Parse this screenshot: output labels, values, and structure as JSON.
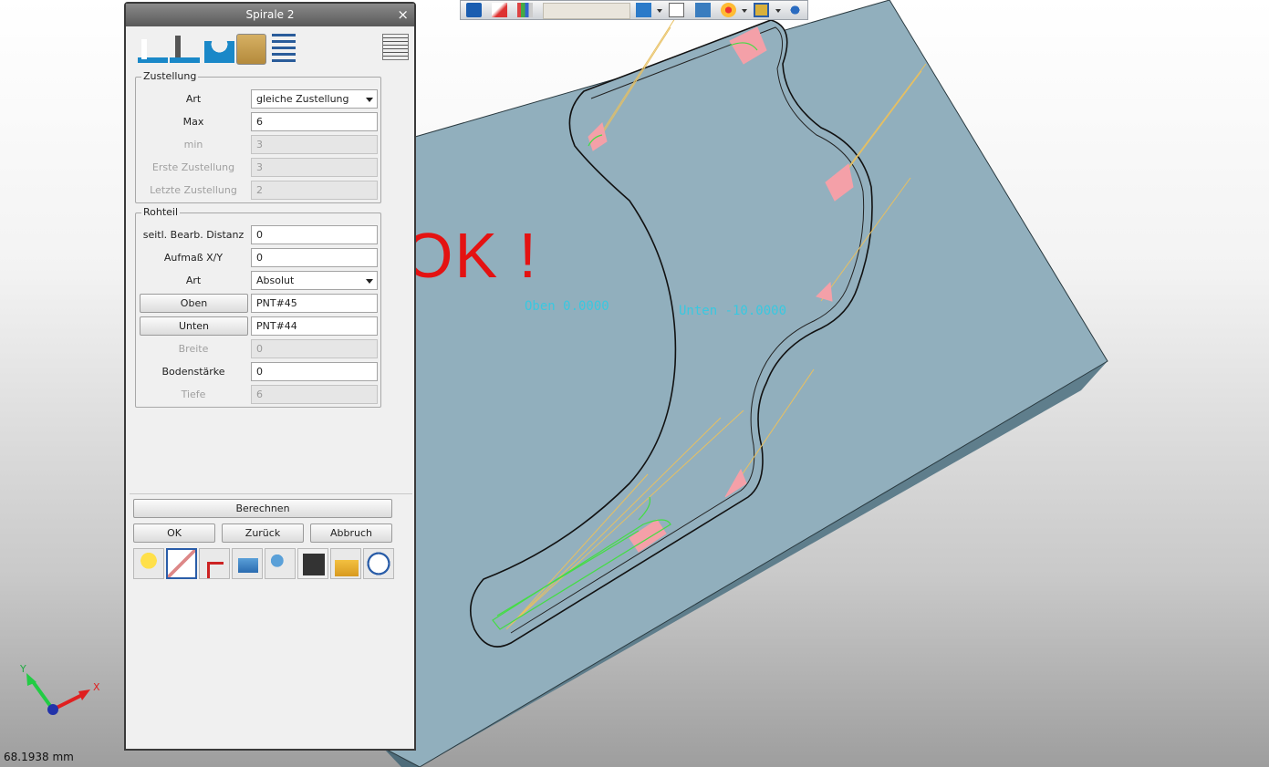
{
  "dialog": {
    "title": "Spirale 2",
    "close_label": "×",
    "tool_icons": [
      "side-distance-icon",
      "depth-distance-icon",
      "surface-contour-icon",
      "stock-box-icon",
      "layers-list-icon",
      "spiral-preview-icon"
    ],
    "zustellung": {
      "legend": "Zustellung",
      "rows": [
        {
          "label": "Art",
          "value": "gleiche Zustellung",
          "type": "select",
          "enabled": true
        },
        {
          "label": "Max",
          "value": "6",
          "type": "input",
          "enabled": true
        },
        {
          "label": "min",
          "value": "3",
          "type": "input",
          "enabled": false
        },
        {
          "label": "Erste Zustellung",
          "value": "3",
          "type": "input",
          "enabled": false
        },
        {
          "label": "Letzte Zustellung",
          "value": "2",
          "type": "input",
          "enabled": false
        }
      ]
    },
    "rohteil": {
      "legend": "Rohteil",
      "rows": [
        {
          "label": "seitl. Bearb. Distanz",
          "value": "0",
          "type": "input",
          "enabled": true
        },
        {
          "label": "Aufmaß X/Y",
          "value": "0",
          "type": "input",
          "enabled": true
        },
        {
          "label": "Art",
          "value": "Absolut",
          "type": "select",
          "enabled": true
        },
        {
          "label": "Oben",
          "value": "PNT#45",
          "type": "button-input",
          "enabled": true
        },
        {
          "label": "Unten",
          "value": "PNT#44",
          "type": "button-input",
          "enabled": true
        },
        {
          "label": "Breite",
          "value": "0",
          "type": "input",
          "enabled": false
        },
        {
          "label": "Bodenstärke",
          "value": "0",
          "type": "input",
          "enabled": true
        },
        {
          "label": "Tiefe",
          "value": "6",
          "type": "input",
          "enabled": false
        }
      ]
    },
    "buttons": {
      "compute": "Berechnen",
      "ok": "OK",
      "back": "Zurück",
      "cancel": "Abbruch"
    },
    "bottom_icons": [
      "lightbulb-icon",
      "edit-sketch-icon",
      "toolpath-icon",
      "tool-settings-icon",
      "parameters-icon",
      "save-icon",
      "load-folder-icon",
      "help-icon"
    ]
  },
  "viewport": {
    "label_top": "Oben  0.0000",
    "label_bottom": "Unten  -10.0000",
    "annotation": "OK !",
    "axis_x": "X",
    "axis_y": "Y",
    "status": "68.1938 mm"
  },
  "toolbar": {
    "icons": [
      "walk-icon",
      "eraser-icon",
      "filter-icon",
      "view-cube-icon",
      "wireframe-cube-icon",
      "shaded-view-icon",
      "render-wheel-icon",
      "display-mode-icon",
      "lighting-icon"
    ]
  },
  "colors": {
    "model": "#91afbd",
    "model_side": "#5f7e8c",
    "toolpath_yellow": "#e8c060",
    "toolpath_green": "#44dd44",
    "toolpath_pink": "#f4a0a8",
    "annotation_red": "#e41212",
    "label_cyan": "#39c8e0"
  }
}
